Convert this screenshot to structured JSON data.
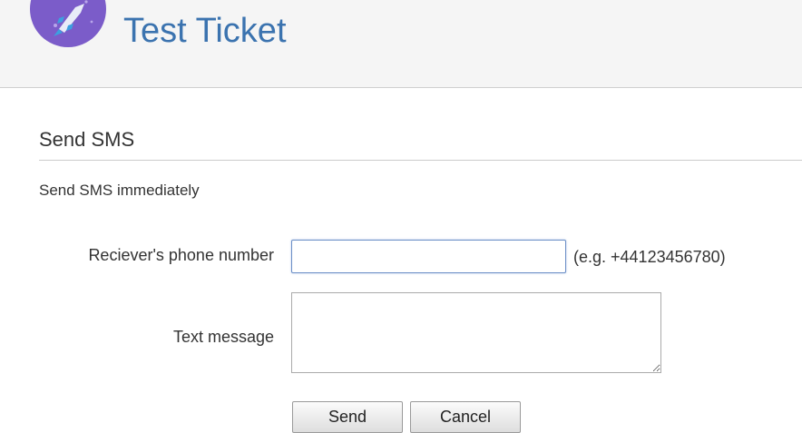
{
  "header": {
    "title": "Test Ticket",
    "logo_icon": "rocket-icon"
  },
  "section": {
    "heading": "Send SMS",
    "description": "Send SMS immediately"
  },
  "form": {
    "phone_label": "Reciever's phone number",
    "phone_value": "",
    "phone_hint": "(e.g. +44123456780)",
    "message_label": "Text message",
    "message_value": "",
    "send_label": "Send",
    "cancel_label": "Cancel"
  },
  "colors": {
    "title": "#3b73af",
    "logo_background": "#7b5cc9",
    "header_background": "#f5f5f5"
  }
}
